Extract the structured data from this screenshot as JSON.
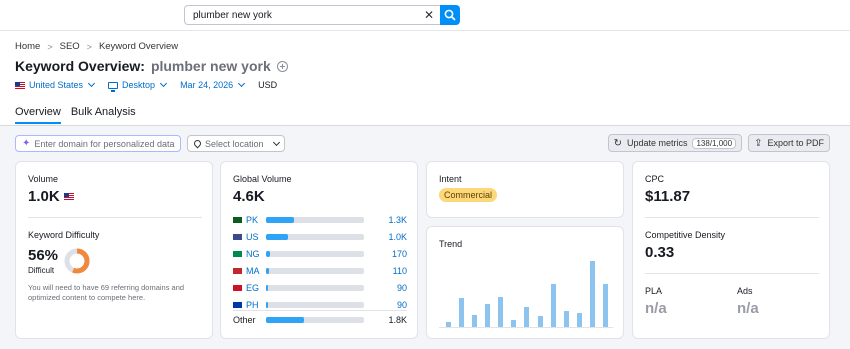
{
  "search": {
    "value": "plumber new york",
    "placeholder": ""
  },
  "breadcrumb": {
    "home": "Home",
    "seo": "SEO",
    "current": "Keyword Overview"
  },
  "title": {
    "prefix": "Keyword Overview:",
    "keyword": "plumber new york"
  },
  "filters": {
    "country": "United States",
    "device": "Desktop",
    "date": "Mar 24, 2026",
    "currency": "USD"
  },
  "tabs": {
    "overview": "Overview",
    "bulk": "Bulk Analysis"
  },
  "toolbar": {
    "domain_placeholder": "Enter domain for personalized data",
    "location_placeholder": "Select location",
    "update_label": "Update metrics",
    "update_count": "138/1,000",
    "export_label": "Export to PDF"
  },
  "volume": {
    "label": "Volume",
    "value": "1.0K"
  },
  "difficulty": {
    "label": "Keyword Difficulty",
    "value": "56%",
    "level": "Difficult",
    "percent": 56,
    "description": "You will need to have 69 referring domains and optimized content to compete here."
  },
  "global_volume": {
    "label": "Global Volume",
    "value": "4.6K",
    "countries": [
      {
        "code": "PK",
        "value": "1.3K",
        "share": 0.29,
        "flag_color": "#0b5d1e"
      },
      {
        "code": "US",
        "value": "1.0K",
        "share": 0.22,
        "flag_color": "#3c4a8c"
      },
      {
        "code": "NG",
        "value": "170",
        "share": 0.04,
        "flag_color": "#008751"
      },
      {
        "code": "MA",
        "value": "110",
        "share": 0.03,
        "flag_color": "#c1272d"
      },
      {
        "code": "EG",
        "value": "90",
        "share": 0.02,
        "flag_color": "#ce1126"
      },
      {
        "code": "PH",
        "value": "90",
        "share": 0.02,
        "flag_color": "#0038a8"
      }
    ],
    "other": {
      "label": "Other",
      "value": "1.8K",
      "share": 0.39
    }
  },
  "intent": {
    "label": "Intent",
    "value": "Commercial"
  },
  "trend": {
    "label": "Trend",
    "values": [
      0.05,
      0.32,
      0.13,
      0.25,
      0.33,
      0.08,
      0.22,
      0.12,
      0.47,
      0.17,
      0.15,
      0.72,
      0.47
    ]
  },
  "cpc": {
    "label": "CPC",
    "value": "$11.87"
  },
  "competitive_density": {
    "label": "Competitive Density",
    "value": "0.33"
  },
  "pla": {
    "label": "PLA",
    "value": "n/a"
  },
  "ads": {
    "label": "Ads",
    "value": "n/a"
  },
  "colors": {
    "accent": "#008ff8",
    "link": "#006dca",
    "bar": "#2fa3f6",
    "trend": "#8cc4ef",
    "difficulty": "#f0883e",
    "intent_bg": "#fcd87a"
  }
}
